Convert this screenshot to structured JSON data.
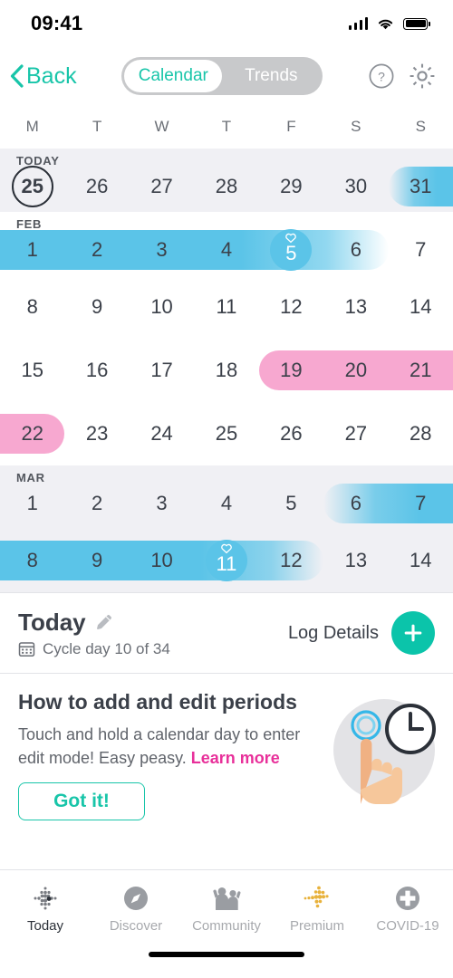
{
  "status_bar": {
    "time": "09:41",
    "signal_icon": "cellular-signal-icon",
    "wifi_icon": "wifi-icon",
    "battery_icon": "battery-icon"
  },
  "nav": {
    "back_label": "Back",
    "segments": [
      {
        "label": "Calendar",
        "active": true
      },
      {
        "label": "Trends",
        "active": false
      }
    ],
    "help_icon": "help-circle-icon",
    "settings_icon": "gear-icon"
  },
  "calendar": {
    "weekdays": [
      "M",
      "T",
      "W",
      "T",
      "F",
      "S",
      "S"
    ],
    "today_label": "TODAY",
    "rows": [
      {
        "month_label": "",
        "bg": "gray",
        "top_label": "TODAY",
        "days": [
          "25",
          "26",
          "27",
          "28",
          "29",
          "30",
          "31"
        ],
        "today_index": 0,
        "bands": [
          {
            "type": "fertile",
            "start": 6,
            "end": 6,
            "cap_left": "fade",
            "cap_right": "flat"
          }
        ]
      },
      {
        "month_label": "FEB",
        "bg": "white",
        "days": [
          "1",
          "2",
          "3",
          "4",
          "5",
          "6",
          "7"
        ],
        "ovulation_index": 4,
        "bands": [
          {
            "type": "fertile",
            "start": 0,
            "end": 5,
            "cap_left": "flat",
            "cap_right": "fade"
          }
        ]
      },
      {
        "month_label": "",
        "bg": "white",
        "days": [
          "8",
          "9",
          "10",
          "11",
          "12",
          "13",
          "14"
        ],
        "bands": []
      },
      {
        "month_label": "",
        "bg": "white",
        "days": [
          "15",
          "16",
          "17",
          "18",
          "19",
          "20",
          "21"
        ],
        "bands": [
          {
            "type": "period",
            "start": 4,
            "end": 6,
            "cap_left": "round",
            "cap_right": "flat"
          }
        ]
      },
      {
        "month_label": "",
        "bg": "white",
        "days": [
          "22",
          "23",
          "24",
          "25",
          "26",
          "27",
          "28"
        ],
        "bands": [
          {
            "type": "period",
            "start": 0,
            "end": 0,
            "cap_left": "flat",
            "cap_right": "round"
          }
        ]
      },
      {
        "month_label": "MAR",
        "bg": "gray",
        "days": [
          "1",
          "2",
          "3",
          "4",
          "5",
          "6",
          "7"
        ],
        "bands": [
          {
            "type": "fertile",
            "start": 5,
            "end": 6,
            "cap_left": "fade",
            "cap_right": "flat"
          }
        ]
      },
      {
        "month_label": "",
        "bg": "gray",
        "days": [
          "8",
          "9",
          "10",
          "11",
          "12",
          "13",
          "14"
        ],
        "ovulation_index": 3,
        "bands": [
          {
            "type": "fertile",
            "start": 0,
            "end": 4,
            "cap_left": "flat",
            "cap_right": "fade"
          }
        ]
      }
    ],
    "colors": {
      "fertile": "#5bc4e8",
      "period": "#f7a8d0",
      "today_ring": "#2b3038",
      "row_future_bg": "#f0f0f4"
    }
  },
  "summary": {
    "title": "Today",
    "edit_icon": "pencil-icon",
    "calendar_icon": "calendar-icon",
    "cycle_text": "Cycle day 10 of 34",
    "log_label": "Log Details",
    "add_icon": "plus-icon",
    "add_color": "#0bc4aa"
  },
  "tip": {
    "heading": "How to add and edit periods",
    "body": "Touch and hold a calendar day to enter edit mode! Easy peasy.",
    "link": "Learn more",
    "link_color": "#e8309a",
    "button": "Got it!",
    "illustration_icon": "touch-and-hold-clock-illustration"
  },
  "tabbar": {
    "items": [
      {
        "label": "Today",
        "icon": "today-dots-icon",
        "active": true
      },
      {
        "label": "Discover",
        "icon": "compass-icon",
        "active": false
      },
      {
        "label": "Community",
        "icon": "people-icon",
        "active": false
      },
      {
        "label": "Premium",
        "icon": "premium-dots-icon",
        "active": false
      },
      {
        "label": "COVID-19",
        "icon": "medical-plus-icon",
        "active": false
      }
    ]
  }
}
